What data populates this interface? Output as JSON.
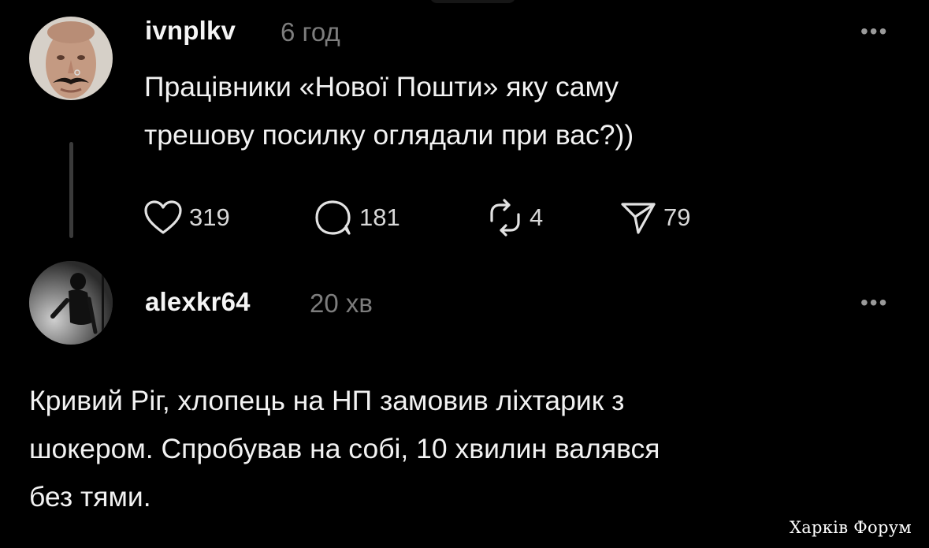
{
  "post1": {
    "username": "ivnplkv",
    "time": "6 год",
    "text_lines": [
      "Працівники «Нової Пошти» яку саму",
      "трешову посилку оглядали при вас?))"
    ],
    "more_icon": "ellipsis-icon",
    "actions": {
      "likes": "319",
      "comments": "181",
      "reposts": "4",
      "shares": "79"
    }
  },
  "post2": {
    "username": "alexkr64",
    "time": "20 хв",
    "more_icon": "ellipsis-icon",
    "text_lines": [
      "Кривий Ріг, хлопець на НП замовив ліхтарик з",
      "шокером. Спробував на собі, 10 хвилин валявся",
      "без тями."
    ]
  },
  "watermark": "Харків Форум",
  "colors": {
    "background": "#000000",
    "text": "#f2f2f2",
    "muted": "#7d7d7d",
    "thread_line": "#3a3a3a"
  }
}
